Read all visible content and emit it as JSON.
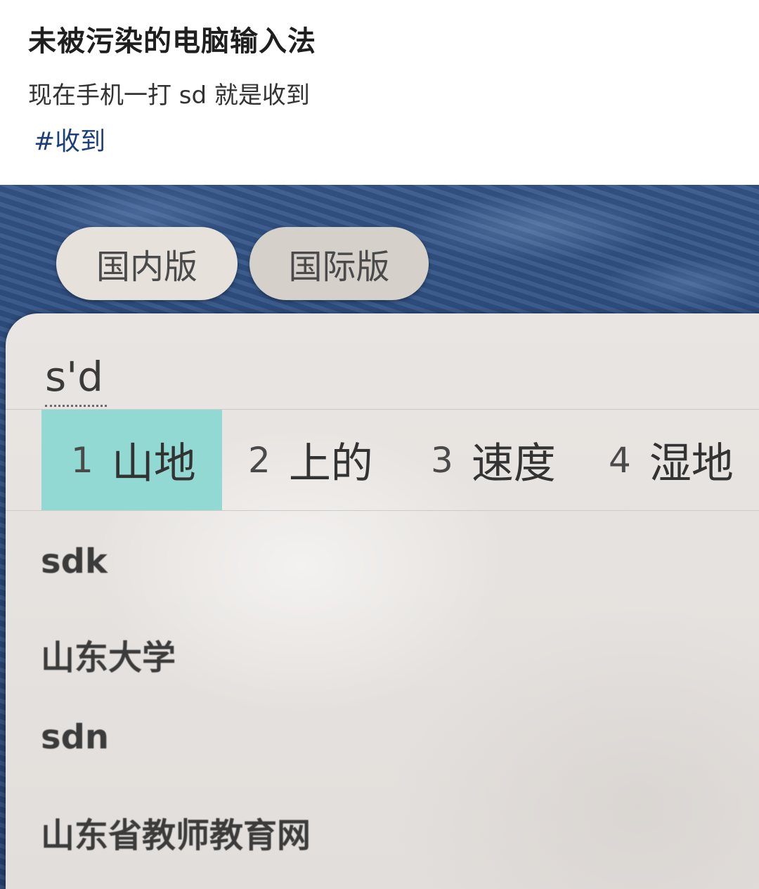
{
  "post": {
    "title": "未被污染的电脑输入法",
    "body": "现在手机一打 sd 就是收到",
    "tag": "#收到"
  },
  "ime": {
    "tabs": [
      {
        "label": "国内版"
      },
      {
        "label": "国际版"
      }
    ],
    "composition": "s'd",
    "candidates": [
      {
        "num": "1",
        "word": "山地",
        "selected": true
      },
      {
        "num": "2",
        "word": "上的",
        "selected": false
      },
      {
        "num": "3",
        "word": "速度",
        "selected": false
      },
      {
        "num": "4",
        "word": "湿地",
        "selected": false
      }
    ],
    "suggestions": [
      {
        "text": "sdk"
      },
      {
        "text": "山东大学"
      },
      {
        "text": "sdn"
      },
      {
        "text": "山东省教师教育网"
      }
    ],
    "colors": {
      "selected_highlight": "#93d9d3",
      "tag_link": "#1f3f7a",
      "background_fabric": "#2b4a7c"
    }
  }
}
